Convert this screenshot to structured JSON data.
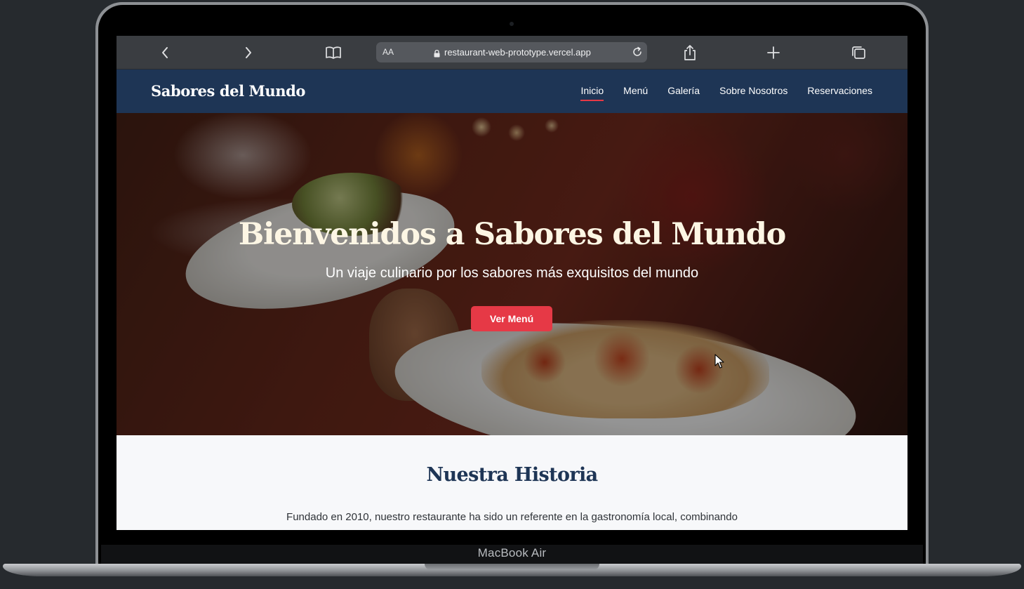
{
  "browser": {
    "aa_label": "AA",
    "url": "restaurant-web-prototype.vercel.app",
    "icons": [
      "back-icon",
      "forward-icon",
      "book-icon",
      "lock-icon",
      "reload-icon",
      "share-icon",
      "plus-icon",
      "tabs-icon"
    ]
  },
  "site": {
    "brand": "Sabores del Mundo",
    "nav": [
      {
        "label": "Inicio",
        "active": true
      },
      {
        "label": "Menú",
        "active": false
      },
      {
        "label": "Galería",
        "active": false
      },
      {
        "label": "Sobre Nosotros",
        "active": false
      },
      {
        "label": "Reservaciones",
        "active": false
      }
    ]
  },
  "hero": {
    "title": "Bienvenidos a Sabores del Mundo",
    "subtitle": "Un viaje culinario por los sabores más exquisitos del mundo",
    "button_label": "Ver Menú"
  },
  "history": {
    "title": "Nuestra Historia",
    "text": "Fundado en 2010, nuestro restaurante ha sido un referente en la gastronomía local, combinando"
  },
  "device": {
    "label": "MacBook Air"
  },
  "colors": {
    "nav_bg": "#1e3555",
    "accent": "#e63946",
    "toolbar_bg": "#3a3d41",
    "section_bg": "#f7f8fa"
  }
}
